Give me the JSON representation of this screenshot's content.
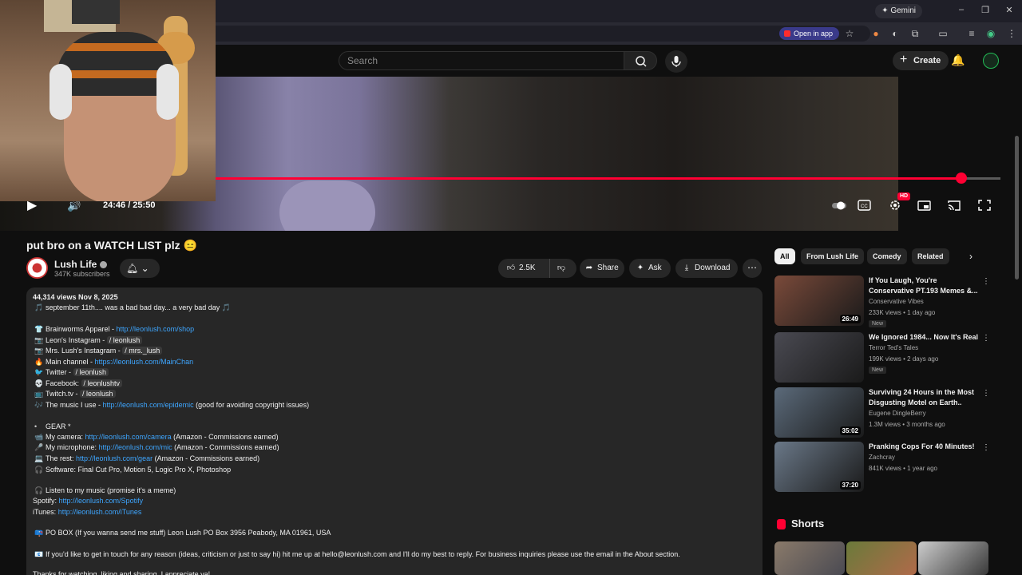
{
  "browser": {
    "gemini_label": "Gemini",
    "open_in_app_label": "Open in app"
  },
  "header": {
    "search_placeholder": "Search",
    "create_label": "Create"
  },
  "player": {
    "time": "24:46 / 25:50",
    "progress": 0.95,
    "hd_badge": "HD"
  },
  "video": {
    "title": "put bro on a WATCH LIST plz 😑",
    "channel_name": "Lush Life",
    "subscribers": "347K subscribers",
    "likes": "2.5K",
    "share_label": "Share",
    "ask_label": "Ask",
    "download_label": "Download"
  },
  "description": {
    "meta": "44,314 views  Nov 8, 2025",
    "lines": [
      {
        "icon": "🎵",
        "text": "september 11th.... was a bad bad day... a very bad day 🎵"
      },
      {
        "icon": "👕",
        "text": "Brainworms Apparel - ",
        "link": "http://leonlush.com/shop"
      },
      {
        "icon": "📷",
        "text": "Leon's Instagram - ",
        "chip": "/ leonlush"
      },
      {
        "icon": "📷",
        "text": "Mrs. Lush's Instagram - ",
        "chip": "/ mrs._lush"
      },
      {
        "icon": "🔥",
        "text": "Main channel - ",
        "link": "https://leonlush.com/MainChan"
      },
      {
        "icon": "🐦",
        "text": "Twitter - ",
        "chip": "/ leonlush"
      },
      {
        "icon": "💀",
        "text": "Facebook: ",
        "chip": "/ leonlushtv"
      },
      {
        "icon": "📺",
        "text": "Twitch.tv - ",
        "chip": "/ leonlush"
      },
      {
        "icon": "🎶",
        "text": "The music I use - ",
        "link": "http://leonlush.com/epidemic",
        "suffix": " (good for avoiding copyright issues)"
      },
      {
        "icon": "•",
        "text": "GEAR *"
      },
      {
        "icon": "📹",
        "text": "My camera: ",
        "link": "http://leonlush.com/camera",
        "suffix": " (Amazon - Commissions earned)"
      },
      {
        "icon": "🎤",
        "text": "My microphone: ",
        "link": "http://leonlush.com/mic",
        "suffix": " (Amazon - Commissions earned)"
      },
      {
        "icon": "💻",
        "text": "The rest: ",
        "link": "http://leonlush.com/gear",
        "suffix": " (Amazon - Commissions earned)"
      },
      {
        "icon": "🎧",
        "text": "Software: Final Cut Pro, Motion 5, Logic Pro X, Photoshop"
      },
      {
        "icon": "🎧",
        "text": "Listen to my music (promise it's a meme)"
      },
      {
        "icon": "",
        "text": "Spotify: ",
        "link": "http://leonlush.com/Spotify"
      },
      {
        "icon": "",
        "text": "iTunes: ",
        "link": "http://leonlush.com/iTunes"
      },
      {
        "icon": "📪",
        "text": "PO BOX (If you wanna send me stuff) Leon Lush PO Box 3956 Peabody, MA 01961, USA"
      },
      {
        "icon": "📧",
        "text": "If you'd like to get in touch for any reason (ideas, criticism or just to say hi) hit me up at hello@leonlush.com and I'll do my best to reply. For business inquiries please use the email in the About section."
      }
    ],
    "last_line": "Thanks for watching, liking and sharing. I appreciate ya!"
  },
  "chips": [
    "All",
    "From Lush Life",
    "Comedy",
    "Related"
  ],
  "recommendations": [
    {
      "title": "If You Laugh, You're Conservative PT.193 Memes &...",
      "channel": "Conservative Vibes",
      "meta": "233K views • 1 day ago",
      "badge": "New",
      "duration": "26:49",
      "color": "#7a4a3a"
    },
    {
      "title": "We Ignored 1984... Now It's Real",
      "channel": "Terror Ted's Tales",
      "meta": "199K views • 2 days ago",
      "badge": "New",
      "duration": "",
      "color": "#4a4a52"
    },
    {
      "title": "Surviving 24 Hours in the Most Disgusting Motel on Earth..",
      "channel": "Eugene DingleBerry",
      "meta": "1.3M views • 3 months ago",
      "badge": "",
      "duration": "35:02",
      "color": "#5b6a7a"
    },
    {
      "title": "Pranking Cops For 40 Minutes!",
      "channel": "Zachcray",
      "meta": "841K views • 1 year ago",
      "badge": "",
      "duration": "37:20",
      "color": "#6a7888"
    }
  ],
  "shorts_label": "Shorts"
}
